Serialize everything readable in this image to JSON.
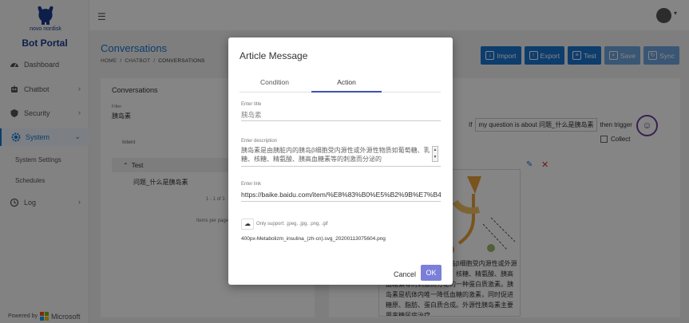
{
  "brand": {
    "logo_text": "novo nordisk",
    "portal_title": "Bot Portal"
  },
  "sidebar": {
    "items": [
      {
        "label": "Dashboard",
        "icon": "dashboard-icon"
      },
      {
        "label": "Chatbot",
        "icon": "robot-icon"
      },
      {
        "label": "Security",
        "icon": "shield-icon"
      },
      {
        "label": "System",
        "icon": "gear-icon"
      },
      {
        "label": "Log",
        "icon": "history-icon"
      }
    ],
    "sub_items": [
      "System Settings",
      "Schedules"
    ],
    "powered_by": "Powered by",
    "microsoft": "Microsoft"
  },
  "page": {
    "title": "Conversations",
    "breadcrumb": [
      "HOME",
      "CHATBOT",
      "CONVERSATIONS"
    ]
  },
  "toolbar": {
    "import": "Import",
    "export": "Export",
    "test": "Test",
    "save": "Save",
    "sync": "Sync"
  },
  "conversations": {
    "heading": "Conversations",
    "filter_label": "Filter",
    "filter_value": "胰岛素",
    "col_intent": "Intent",
    "group": "Test",
    "question": "问题_什么是胰岛素",
    "pager": "1 - 1 of 1",
    "per_page": "Items per page:"
  },
  "rule": {
    "prefix": "If",
    "condition": "my question is about 问题_什么是胰岛素",
    "suffix": "then trigger",
    "collect": "Collect"
  },
  "article_image": {
    "caption": "胰岛素是由胰脏内的胰岛β细胞受内源性或外源性物质如葡萄糖、乳糖、核糖、精氨酸、胰高血糖素等的刺激而分泌的一种蛋白质激素。胰岛素是机体内唯一降低血糖的激素，同时促进糖原、脂肪、蛋白质合成。外源性胰岛素主要用来糖尿病治疗。"
  },
  "dialog": {
    "title": "Article Message",
    "tabs": [
      "Condition",
      "Action"
    ],
    "title_label": "Enter title",
    "title_value": "胰岛素",
    "desc_label": "Enter description",
    "desc_value": "胰岛素是由胰脏内的胰岛β细胞受内源性或外源性物质如葡萄糖、乳糖、核糖、精氨酸、胰高血糖素等的刺激而分泌的",
    "link_label": "Enter link",
    "link_value": "https://baike.baidu.com/item/%E8%83%B0%E5%B2%9B%E7%B4%A0",
    "support": "Only support: .jpeg, .jpg, .png, .gif",
    "filename": "400px-Metabolizm_insulina_(zh-cn).svg_20200113075604.png",
    "cancel": "Cancel",
    "ok": "OK"
  },
  "colors": {
    "primary": "#1976d2",
    "ok_button": "#7b7fd9",
    "brand": "#1a3a8f"
  }
}
